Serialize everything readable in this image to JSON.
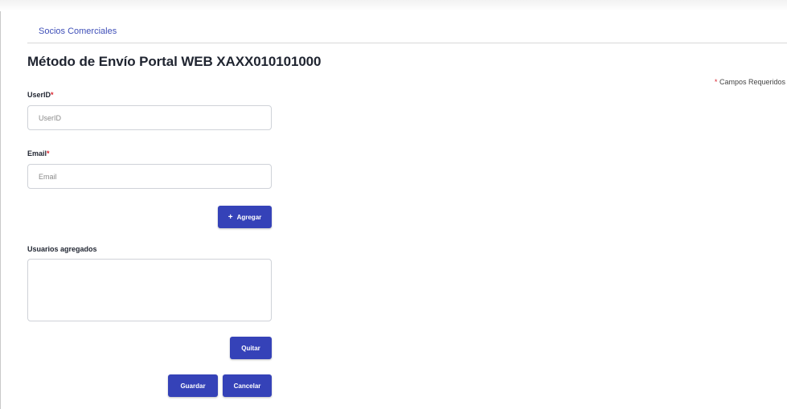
{
  "breadcrumb": {
    "label": "Socios Comerciales"
  },
  "page": {
    "title": "Método de Envío Portal WEB XAXX010101000"
  },
  "required_note": {
    "star": "*",
    "text": "Campos Requeridos"
  },
  "form": {
    "userid": {
      "label": "UserID",
      "star": "*",
      "placeholder": "UserID",
      "value": ""
    },
    "email": {
      "label": "Email",
      "star": "*",
      "placeholder": "Email",
      "value": ""
    },
    "add_button": {
      "icon": "plus-icon",
      "label": "Agregar"
    },
    "users_list": {
      "label": "Usuarios agregados",
      "value": ""
    },
    "remove_button": {
      "label": "Quitar"
    },
    "save_button": {
      "label": "Guardar"
    },
    "cancel_button": {
      "label": "Cancelar"
    }
  },
  "colors": {
    "primary": "#3542b8",
    "required": "#d9232e",
    "link": "#3f4fb8"
  }
}
